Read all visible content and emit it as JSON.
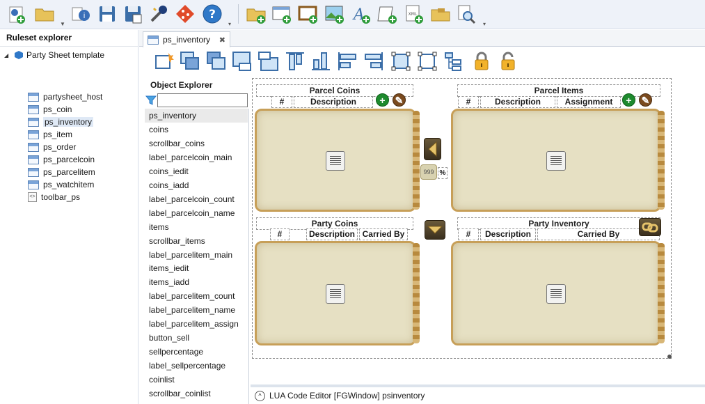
{
  "toolbar": {
    "icons": [
      "new-ruleset-icon",
      "open-folder-icon",
      "ruleset-info-icon",
      "save-icon",
      "save-as-icon",
      "build-icon",
      "git-icon",
      "help-icon",
      "new-folder-icon",
      "new-window-icon",
      "new-frame-icon",
      "new-image-icon",
      "new-font-icon",
      "new-script-icon",
      "new-xml-icon",
      "new-archive-icon",
      "find-icon"
    ]
  },
  "ruleset_explorer": {
    "title": "Ruleset explorer",
    "root": "Party Sheet template",
    "items": [
      {
        "label": "partysheet_host",
        "type": "window"
      },
      {
        "label": "ps_coin",
        "type": "window"
      },
      {
        "label": "ps_inventory",
        "type": "window"
      },
      {
        "label": "ps_item",
        "type": "window"
      },
      {
        "label": "ps_order",
        "type": "window"
      },
      {
        "label": "ps_parcelcoin",
        "type": "window"
      },
      {
        "label": "ps_parcelitem",
        "type": "window"
      },
      {
        "label": "ps_watchitem",
        "type": "window"
      },
      {
        "label": "toolbar_ps",
        "type": "xml"
      }
    ],
    "selected": "ps_inventory"
  },
  "tab": {
    "label": "ps_inventory",
    "close": "✖"
  },
  "object_explorer": {
    "title": "Object Explorer",
    "filter_value": "",
    "items": [
      "ps_inventory",
      "coins",
      "scrollbar_coins",
      "label_parcelcoin_main",
      "coins_iedit",
      "coins_iadd",
      "label_parcelcoin_count",
      "label_parcelcoin_name",
      "items",
      "scrollbar_items",
      "label_parcelitem_main",
      "items_iedit",
      "items_iadd",
      "label_parcelitem_count",
      "label_parcelitem_name",
      "label_parcelitem_assign",
      "button_sell",
      "sellpercentage",
      "label_sellpercentage",
      "coinlist",
      "scrollbar_coinlist"
    ],
    "selected": "ps_inventory"
  },
  "canvas": {
    "parcel_coins": {
      "title": "Parcel Coins",
      "count_col": "#",
      "name_col": "Description"
    },
    "parcel_items": {
      "title": "Parcel Items",
      "count_col": "#",
      "name_col": "Description",
      "assign_col": "Assignment"
    },
    "party_coins": {
      "title": "Party Coins",
      "count_col": "#",
      "name_col": "Description",
      "carried_col": "Carried By"
    },
    "party_inventory": {
      "title": "Party Inventory",
      "count_col": "#",
      "name_col": "Description",
      "carried_col": "Carried By"
    },
    "sell_value": "999",
    "sell_pct": "%",
    "add_symbol": "+",
    "edit_symbol": "✎"
  },
  "lua_bar": {
    "label": "LUA Code Editor [FGWindow] psinventory",
    "expand": "^"
  }
}
